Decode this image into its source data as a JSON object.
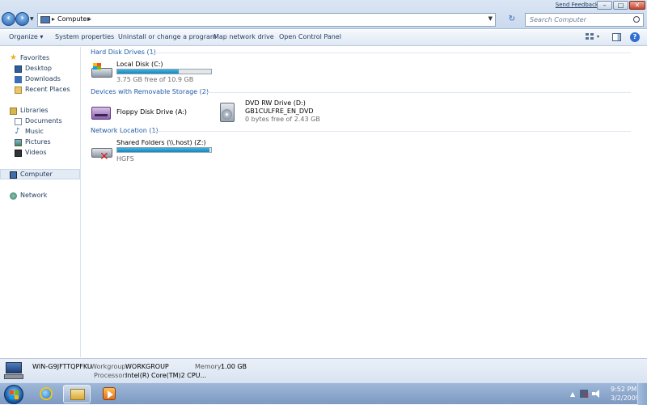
{
  "window": {
    "feedback_link": "Send Feedback",
    "minimize": "–",
    "maximize": "□",
    "close": "✕"
  },
  "nav": {
    "back": "‹",
    "forward": "›",
    "history_dropdown": "▼",
    "refresh": "↻"
  },
  "address": {
    "sep1": "▸",
    "path": "Computer",
    "sep2": "▸",
    "dropdown": "▼"
  },
  "search": {
    "placeholder": "Search Computer"
  },
  "commands": {
    "organize": "Organize ▾",
    "system_properties": "System properties",
    "uninstall": "Uninstall or change a program",
    "map_drive": "Map network drive",
    "control_panel": "Open Control Panel",
    "view_drop": "▾",
    "help": "?"
  },
  "sidebar": {
    "favorites": "Favorites",
    "desktop": "Desktop",
    "downloads": "Downloads",
    "recent_places": "Recent Places",
    "libraries": "Libraries",
    "documents": "Documents",
    "music": "Music",
    "pictures": "Pictures",
    "videos": "Videos",
    "computer": "Computer",
    "network": "Network"
  },
  "groups": {
    "hdd": "Hard Disk Drives (1)",
    "removable": "Devices with Removable Storage (2)",
    "network": "Network Location (1)"
  },
  "drives": {
    "local": {
      "name": "Local Disk (C:)",
      "free": "3.75 GB free of 10.9 GB",
      "used_fraction": 0.656
    },
    "floppy": {
      "name": "Floppy Disk Drive (A:)"
    },
    "dvd": {
      "name": "DVD RW Drive (D:)",
      "label": "GB1CULFRE_EN_DVD",
      "free": "0 bytes free of 2.43 GB"
    },
    "shared": {
      "name": "Shared Folders (\\\\.host) (Z:)",
      "label": "HGFS",
      "used_fraction": 0.98
    }
  },
  "details": {
    "computer_name": "WIN-G9JFTTQPFKU",
    "workgroup_key": "Workgroup:",
    "workgroup_val": "WORKGROUP",
    "memory_key": "Memory:",
    "memory_val": "1.00 GB",
    "processor_key": "Processor:",
    "processor_val": "Intel(R) Core(TM)2 CPU..."
  },
  "tray": {
    "show_hidden": "▲",
    "net_status": "✕",
    "time": "9:52 PM",
    "date": "3/2/2009"
  },
  "colors": {
    "accent": "#1e5aa8",
    "bar_fill": "#1c86b8",
    "taskbar": "#7c99c2"
  }
}
